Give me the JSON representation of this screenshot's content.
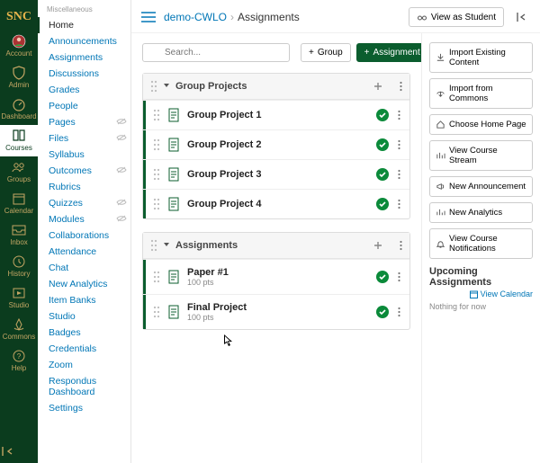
{
  "rail": {
    "logo_text": "SNC",
    "items": [
      {
        "key": "account",
        "label": "Account"
      },
      {
        "key": "admin",
        "label": "Admin"
      },
      {
        "key": "dashboard",
        "label": "Dashboard"
      },
      {
        "key": "courses",
        "label": "Courses"
      },
      {
        "key": "groups",
        "label": "Groups"
      },
      {
        "key": "calendar",
        "label": "Calendar"
      },
      {
        "key": "inbox",
        "label": "Inbox"
      },
      {
        "key": "history",
        "label": "History"
      },
      {
        "key": "studio",
        "label": "Studio"
      },
      {
        "key": "commons",
        "label": "Commons"
      },
      {
        "key": "help",
        "label": "Help"
      }
    ]
  },
  "secondary": {
    "header": "Miscellaneous",
    "items": [
      {
        "label": "Home",
        "active": true
      },
      {
        "label": "Announcements"
      },
      {
        "label": "Assignments"
      },
      {
        "label": "Discussions"
      },
      {
        "label": "Grades"
      },
      {
        "label": "People"
      },
      {
        "label": "Pages",
        "hidden": true
      },
      {
        "label": "Files",
        "hidden": true
      },
      {
        "label": "Syllabus"
      },
      {
        "label": "Outcomes",
        "hidden": true
      },
      {
        "label": "Rubrics"
      },
      {
        "label": "Quizzes",
        "hidden": true
      },
      {
        "label": "Modules",
        "hidden": true
      },
      {
        "label": "Collaborations"
      },
      {
        "label": "Attendance"
      },
      {
        "label": "Chat"
      },
      {
        "label": "New Analytics"
      },
      {
        "label": "Item Banks"
      },
      {
        "label": "Studio"
      },
      {
        "label": "Badges"
      },
      {
        "label": "Credentials"
      },
      {
        "label": "Zoom"
      },
      {
        "label": "Respondus Dashboard"
      },
      {
        "label": "Settings"
      }
    ]
  },
  "breadcrumb": {
    "course": "demo-CWLO",
    "page": "Assignments"
  },
  "topbar": {
    "view_as_student": "View as Student"
  },
  "toolbar": {
    "search_placeholder": "Search...",
    "group_btn": "Group",
    "assignment_btn": "Assignment"
  },
  "groups": [
    {
      "title": "Group Projects",
      "rows": [
        {
          "title": "Group Project 1"
        },
        {
          "title": "Group Project 2"
        },
        {
          "title": "Group Project 3"
        },
        {
          "title": "Group Project 4"
        }
      ]
    },
    {
      "title": "Assignments",
      "rows": [
        {
          "title": "Paper #1",
          "sub": "100 pts"
        },
        {
          "title": "Final Project",
          "sub": "100 pts"
        }
      ]
    }
  ],
  "right": {
    "buttons": [
      "Import Existing Content",
      "Import from Commons",
      "Choose Home Page",
      "View Course Stream",
      "New Announcement",
      "New Analytics",
      "View Course Notifications"
    ],
    "upcoming_header": "Upcoming Assignments",
    "view_calendar": "View Calendar",
    "nothing": "Nothing for now"
  }
}
